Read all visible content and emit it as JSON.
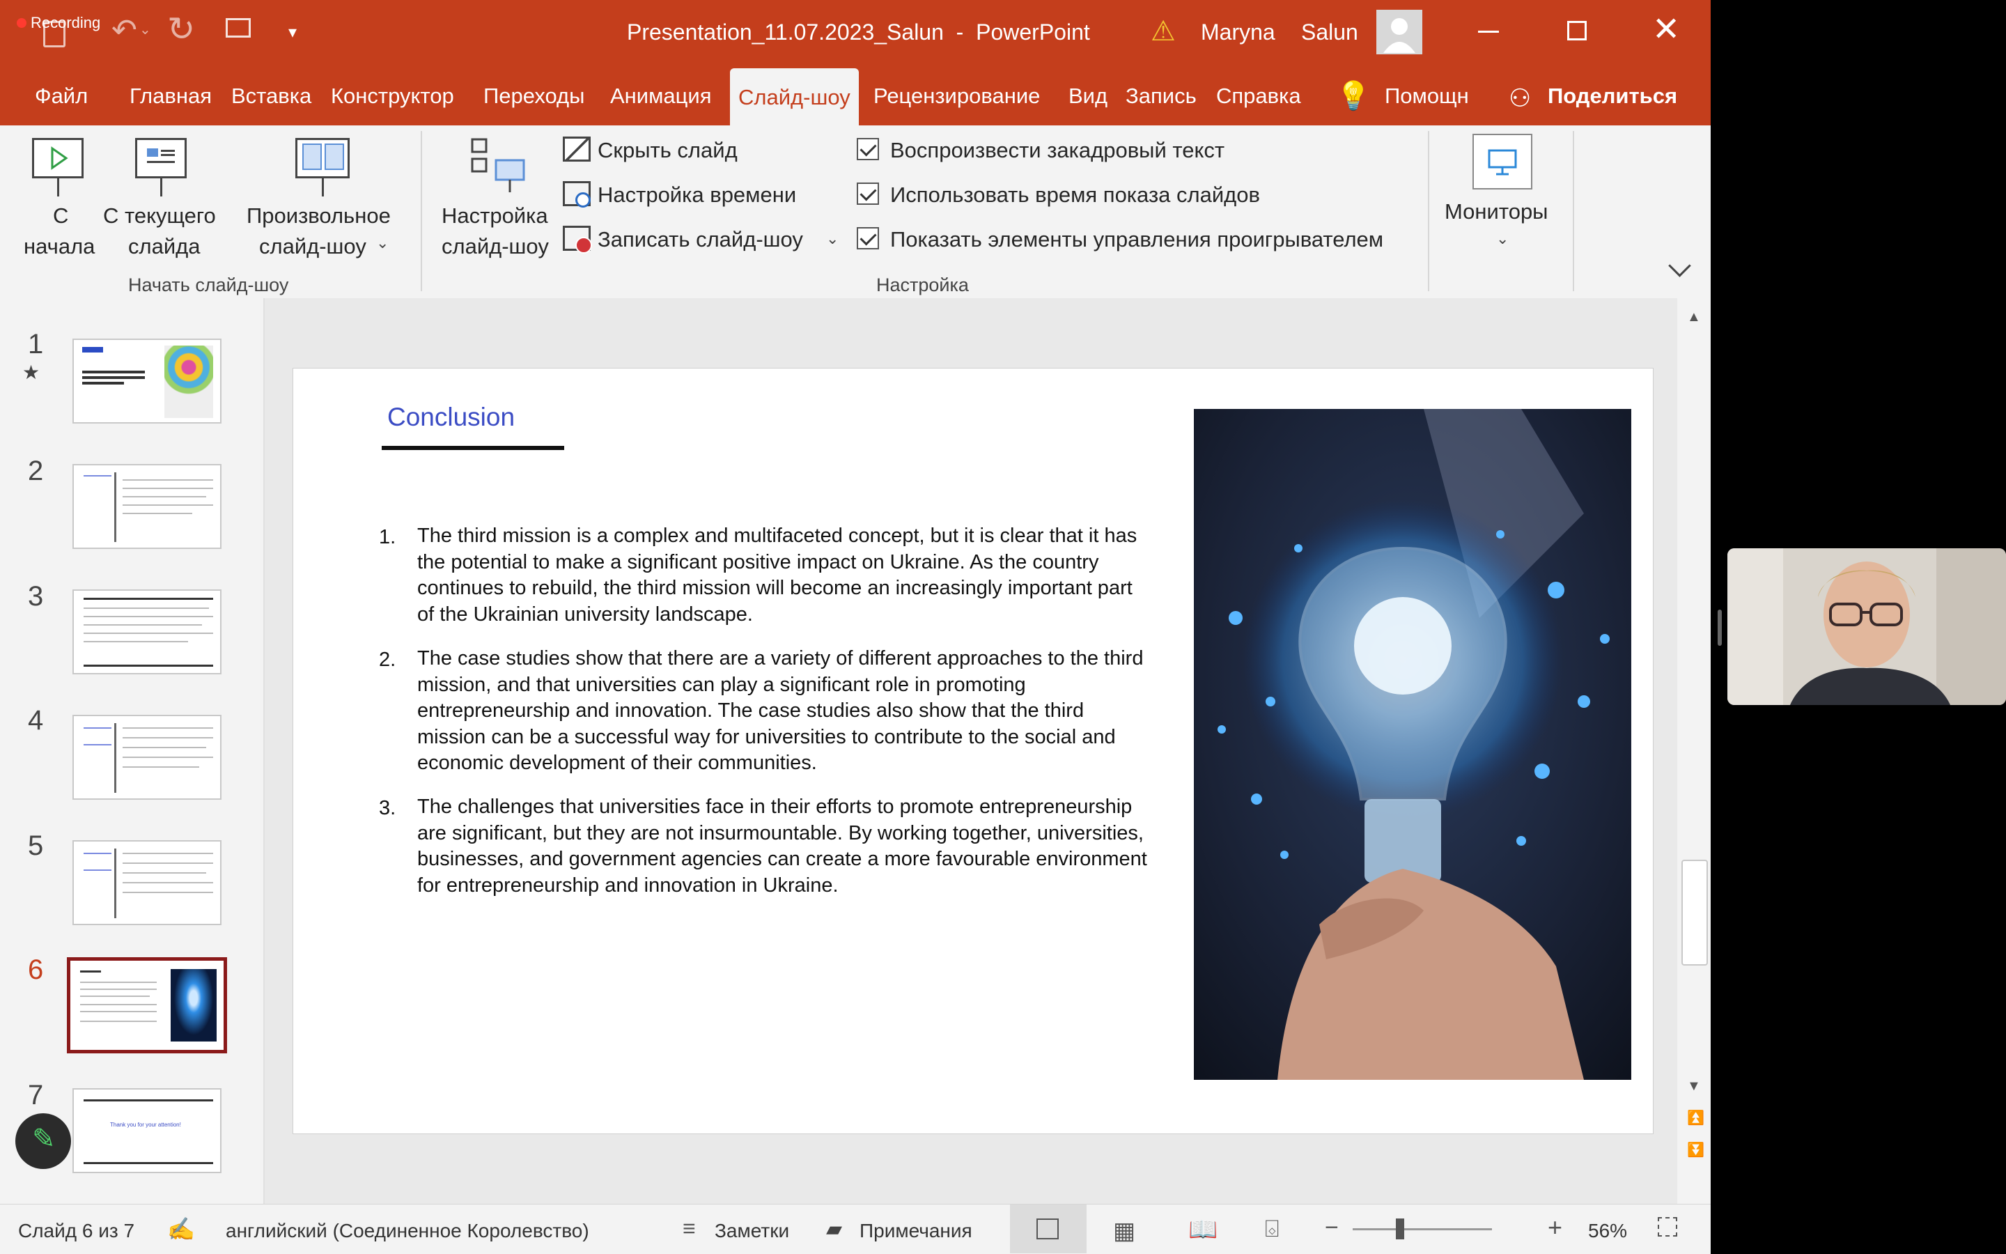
{
  "window": {
    "title": "Presentation_11.07.2023_Salun  -  PowerPoint",
    "recording_label": "Recording",
    "user_first": "Maryna",
    "user_last": "Salun"
  },
  "tabs": [
    "Файл",
    "Главная",
    "Вставка",
    "Конструктор",
    "Переходы",
    "Анимация",
    "Слайд-шоу",
    "Рецензирование",
    "Вид",
    "Запись",
    "Справка"
  ],
  "active_tab": "Слайд-шоу",
  "tab_help_search": "Помощн",
  "tab_share": "Поделиться",
  "ribbon": {
    "from_start_1": "С",
    "from_start_2": "начала",
    "from_current_1": "С текущего",
    "from_current_2": "слайда",
    "custom_show_1": "Произвольное",
    "custom_show_2": "слайд-шоу",
    "group_start_label": "Начать слайд-шоу",
    "setup_1": "Настройка",
    "setup_2": "слайд-шоу",
    "hide_slide": "Скрыть слайд",
    "rehearse": "Настройка времени",
    "record": "Записать слайд-шоу",
    "check_narration": "Воспроизвести закадровый текст",
    "check_timings": "Использовать время показа слайдов",
    "check_controls": "Показать элементы управления проигрывателем",
    "group_setup_label": "Настройка",
    "monitors": "Мониторы"
  },
  "thumbnails": [
    {
      "num": "1"
    },
    {
      "num": "2"
    },
    {
      "num": "3"
    },
    {
      "num": "4"
    },
    {
      "num": "5"
    },
    {
      "num": "6"
    },
    {
      "num": "7"
    }
  ],
  "thumb7_text": "Thank you for your attention!",
  "slide": {
    "title": "Conclusion",
    "items": [
      {
        "num": "1.",
        "text": "The third mission is a complex and multifaceted concept, but it is clear that it has the potential to make a significant positive impact on Ukraine. As the country continues to rebuild, the third mission will become an increasingly important part of the Ukrainian university landscape."
      },
      {
        "num": "2.",
        "text": "The case studies show that there are a variety of different approaches to the third mission, and that universities can play a significant role in promoting entrepreneurship and innovation. The case studies also show that the third mission can be a successful way for universities to contribute to the social and economic development of their communities."
      },
      {
        "num": "3.",
        "text": "The challenges that universities face in their efforts to promote entrepreneurship are significant, but they are not insurmountable. By working together, universities, businesses, and government agencies can create a more favourable environment for entrepreneurship and innovation in Ukraine."
      }
    ]
  },
  "status": {
    "slide_of": "Слайд 6 из 7",
    "language": "английский (Соединенное Королевство)",
    "notes": "Заметки",
    "comments": "Примечания",
    "zoom": "56%"
  },
  "colors": {
    "accent": "#c43e1c",
    "title_blue": "#3b4cc4",
    "selected_thumb": "#8b1a1a"
  }
}
